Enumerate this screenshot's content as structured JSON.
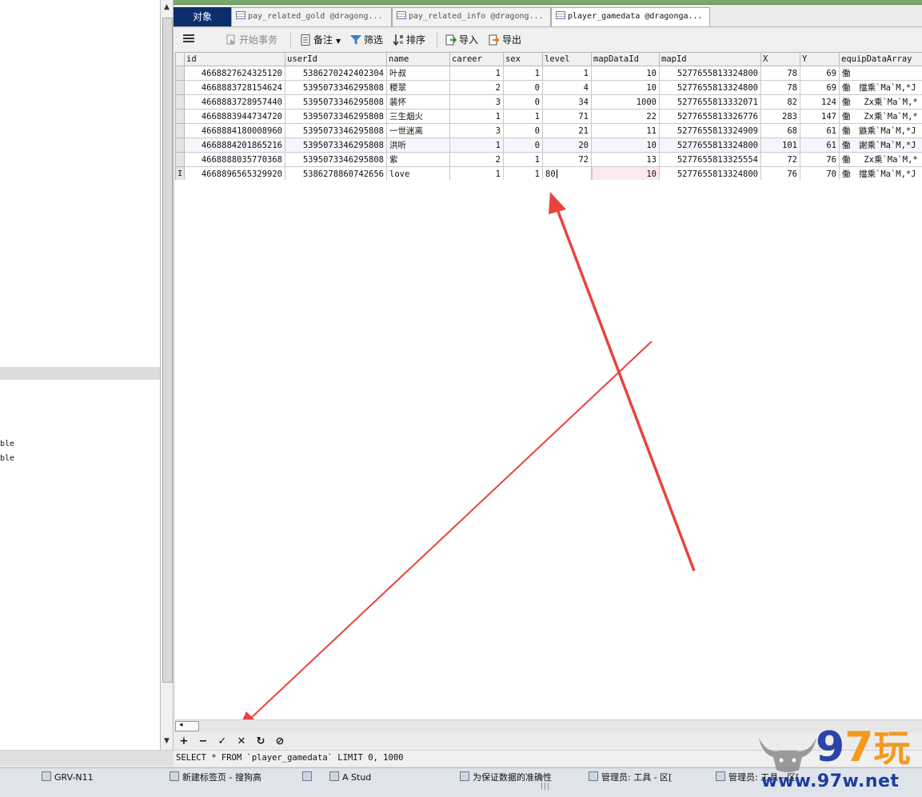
{
  "tabs": [
    {
      "label": "对象"
    },
    {
      "label": "pay_related_gold @dragong..."
    },
    {
      "label": "pay_related_info @dragong..."
    },
    {
      "label": "player_gamedata @dragonga..."
    }
  ],
  "toolbar": {
    "begin_transaction": "开始事务",
    "memo": "备注",
    "filter": "筛选",
    "sort": "排序",
    "import": "导入",
    "export": "导出"
  },
  "left_panel": {
    "items": [
      "ble",
      "ble"
    ]
  },
  "grid": {
    "columns": [
      "id",
      "userId",
      "name",
      "career",
      "sex",
      "level",
      "mapDataId",
      "mapId",
      "X",
      "Y",
      "equipDataArray"
    ],
    "rows": [
      [
        "4668827624325120",
        "5386270242402304",
        "叶叔",
        "1",
        "1",
        "1",
        "10",
        "5277655813324800",
        "78",
        "69",
        "働"
      ],
      [
        "4668883728154624",
        "5395073346295808",
        "稷翠",
        "2",
        "0",
        "4",
        "10",
        "5277655813324800",
        "78",
        "69",
        "働　擋乘`Ma`M,*J"
      ],
      [
        "4668883728957440",
        "5395073346295808",
        "裴怀",
        "3",
        "0",
        "34",
        "1000",
        "5277655813332071",
        "82",
        "124",
        "働　 Zx乘`Ma`M,*"
      ],
      [
        "4668883944734720",
        "5395073346295808",
        "三生烟火",
        "1",
        "1",
        "71",
        "22",
        "5277655813326776",
        "283",
        "147",
        "働　 Zx乘`Ma`M,*"
      ],
      [
        "4668884180008960",
        "5395073346295808",
        "一世迷离",
        "3",
        "0",
        "21",
        "11",
        "5277655813324909",
        "68",
        "61",
        "働　鏃乘`Ma`M,*J"
      ],
      [
        "4668884201865216",
        "5395073346295808",
        "洪听",
        "1",
        "0",
        "20",
        "10",
        "5277655813324800",
        "101",
        "61",
        "働　謝乘`Ma`M,*J"
      ],
      [
        "4668888035770368",
        "5395073346295808",
        "紫",
        "2",
        "1",
        "72",
        "13",
        "5277655813325554",
        "72",
        "76",
        "働　 Zx乘`Ma`M,*"
      ],
      [
        "4668896565329920",
        "5386278860742656",
        "love",
        "1",
        "1",
        "80",
        "10",
        "5277655813324800",
        "76",
        "70",
        "働　擋乘`Ma`M,*J"
      ]
    ]
  },
  "status": {
    "sql": "SELECT * FROM `player_gamedata` LIMIT 0, 1000"
  },
  "taskbar": {
    "items": [
      "GRV-N11",
      "新建标签页 - 搜狗高",
      "",
      "A Stud",
      "为保证数据的准确性",
      "管理员: 工具 - 区[",
      "管理员: 工具 - 区["
    ]
  },
  "watermark": {
    "digits_9": "9",
    "digits_7": "7",
    "cn": "玩",
    "url": "www.97w.net"
  },
  "colors": {
    "objects_tab": "#0a2d6b",
    "annotation_arrow": "#e8433f",
    "watermark_blue": "#1d3d9e",
    "watermark_orange": "#f39a1e"
  }
}
